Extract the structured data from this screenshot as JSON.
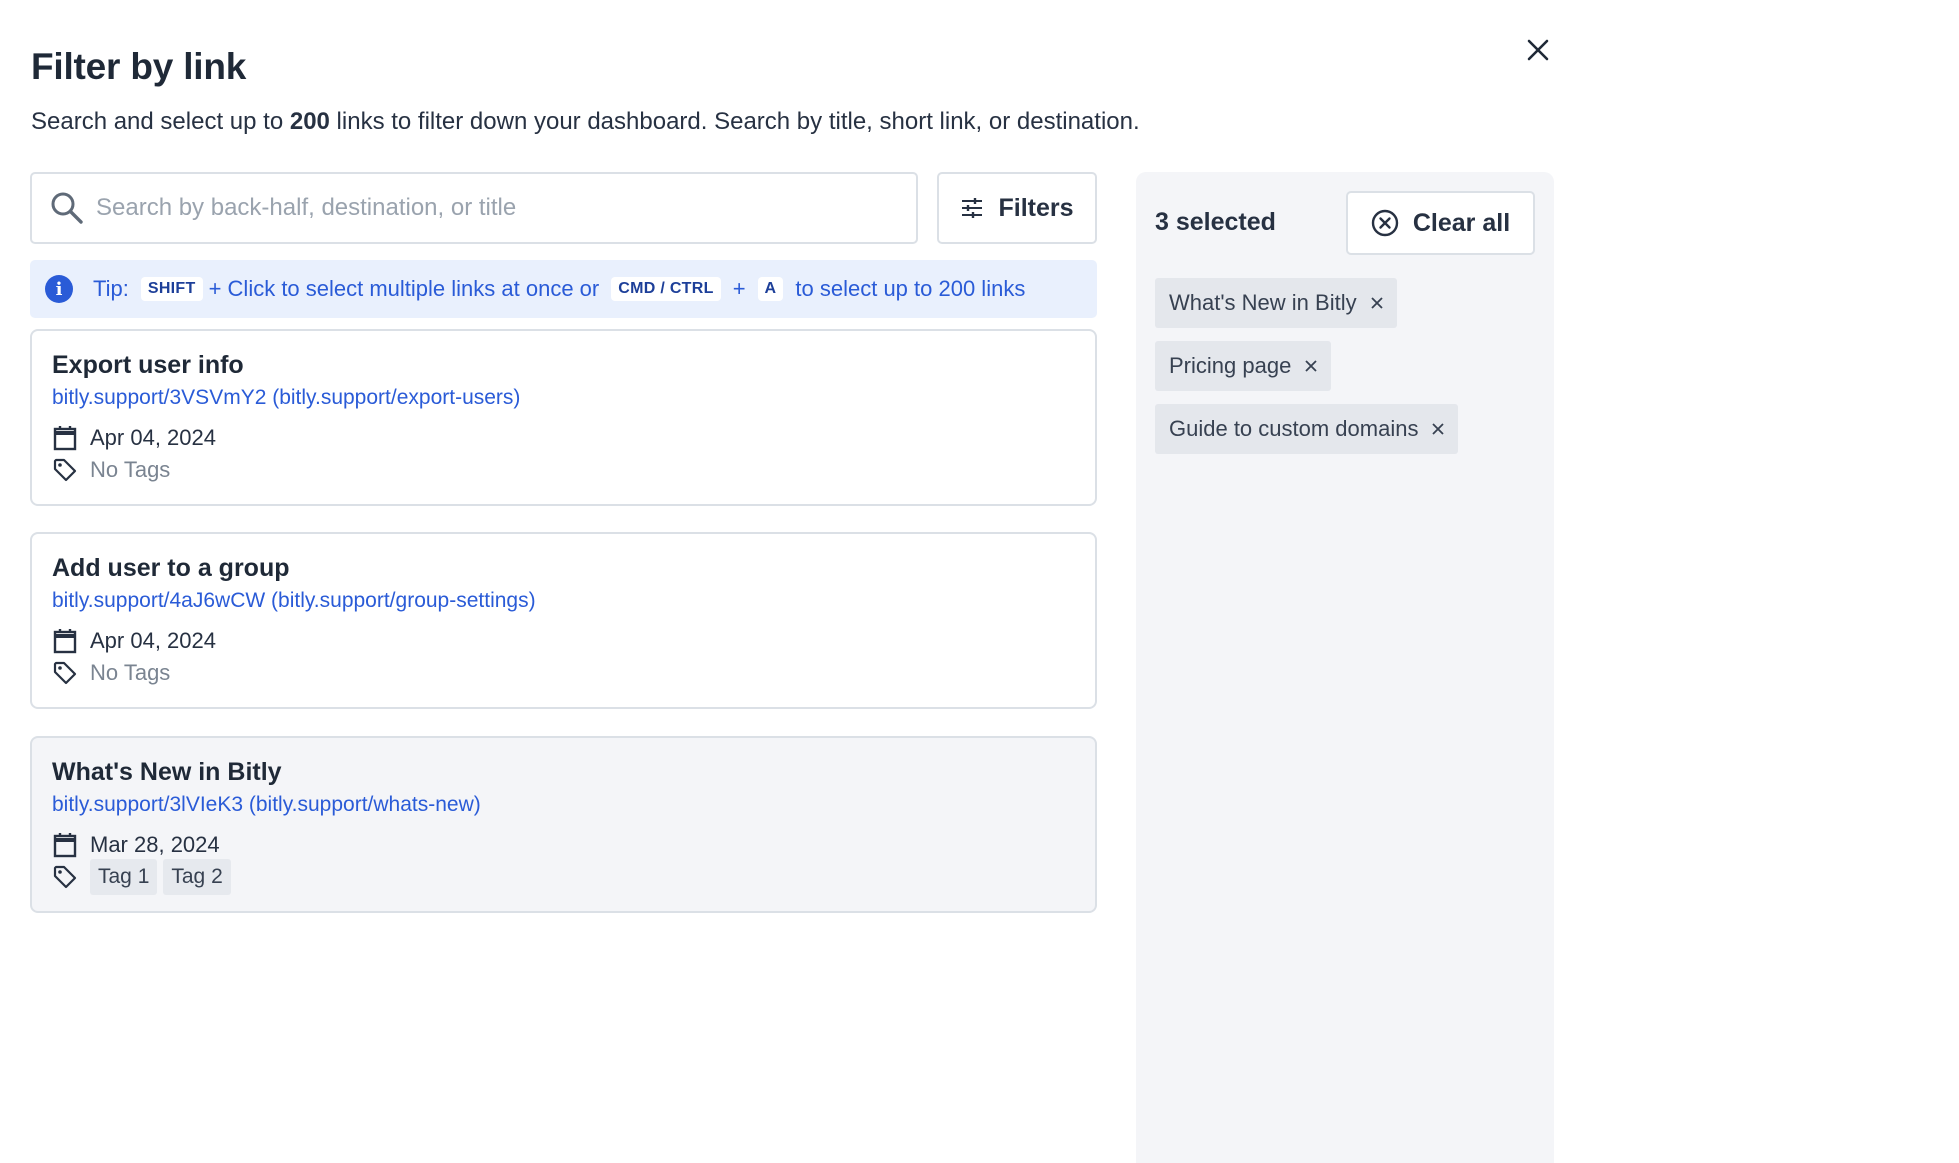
{
  "dialog": {
    "title": "Filter by link",
    "subtitle_pre": "Search and select up to ",
    "subtitle_bold": "200",
    "subtitle_post": " links to filter down your dashboard. Search by title, short link, or destination."
  },
  "search": {
    "placeholder": "Search by back-half, destination, or title",
    "value": ""
  },
  "filters_button": {
    "label": "Filters"
  },
  "tip": {
    "prefix": "Tip:",
    "key1": "SHIFT",
    "text1": "+ Click to select multiple links at once or",
    "key2": "CMD / CTRL",
    "plus": "+",
    "key3": "A",
    "text2": "to select up to 200 links"
  },
  "links": [
    {
      "title": "Export user info",
      "link": "bitly.support/3VSVmY2 (bitly.support/export-users)",
      "date": "Apr 04, 2024",
      "no_tags": "No Tags",
      "tags": [],
      "selected": false
    },
    {
      "title": "Add user to a group",
      "link": "bitly.support/4aJ6wCW (bitly.support/group-settings)",
      "date": "Apr 04, 2024",
      "no_tags": "No Tags",
      "tags": [],
      "selected": false
    },
    {
      "title": "What's New in Bitly",
      "link": "bitly.support/3lVIeK3 (bitly.support/whats-new)",
      "date": "Mar 28, 2024",
      "no_tags": "",
      "tags": [
        "Tag 1",
        "Tag 2"
      ],
      "selected": true
    }
  ],
  "selection": {
    "count_label": "3 selected",
    "clear_label": "Clear all",
    "chips": [
      "What's New in Bitly",
      "Pricing page",
      "Guide to custom domains"
    ]
  },
  "colors": {
    "accent": "#2a5bd7",
    "tip_bg": "#e9f0fd",
    "panel_bg": "#f4f5f8",
    "border": "#dbe0e6"
  }
}
